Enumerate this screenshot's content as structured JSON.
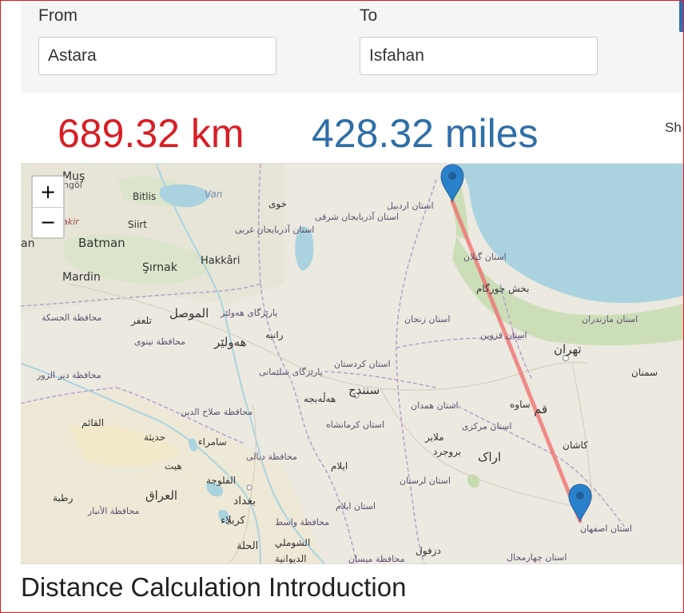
{
  "form": {
    "from_label": "From",
    "from_value": "Astara",
    "to_label": "To",
    "to_value": "Isfahan"
  },
  "result": {
    "km": "689.32 km",
    "miles": "428.32 miles",
    "share_stub": "Sh"
  },
  "colors": {
    "km": "#d71f26",
    "miles": "#2f6ea8",
    "route": "#ef6b6b",
    "marker": "#2a81cb",
    "water": "#aad3df",
    "land": "#ece9e1",
    "border": "#b39bc8"
  },
  "map": {
    "zoom_in": "+",
    "zoom_out": "−",
    "labels": {
      "mus": "Muş",
      "bingol": "ingöl",
      "bitlis": "Bitlis",
      "van": "Van",
      "siirt": "Siirt",
      "batman": "Batman",
      "hakkari": "Hakkâri",
      "sirnak": "Şırnak",
      "mardin": "Mardin",
      "akir": "akir",
      "an": "an",
      "ardabil_prov": "استان اردبیل",
      "khoy": "خوی",
      "w_azarbaijan": "استان آذربایجان غربی",
      "e_azarbaijan": "استان آذربایجان شرقی",
      "gilan": "استان گیلان",
      "bakhsh": "بخش چورگام",
      "zanjan": "استان زنجان",
      "mazandaran": "استان مازندران",
      "qazvin": "استان قزوین",
      "tehran": "تهران",
      "semnan": "سمنان",
      "mosul": "الموصل",
      "nineveh": "محافظة نينوى",
      "hasakah": "محافظة الحسكة",
      "erbil": "هەولێر",
      "erbil_gov": "پارێزگای هەولێر",
      "raniyeh": "رانیه",
      "talafar": "تلعفر",
      "deir": "محافظة دير الزور",
      "kurdistan": "استان کردستان",
      "sanandaj": "سنندج",
      "sulaymaniyah": "پارێزگای سلێمانی",
      "halabja": "هەڵەبجە",
      "hamadan": "استان همدان",
      "saveh": "ساوه",
      "qom": "قم",
      "kermanshah": "استان کرمانشاه",
      "markazi": "استان مرکزی",
      "kashan": "کاشان",
      "qaim": "القائم",
      "haditha": "حديثة",
      "salahaddin": "محافظة صلاح الدين",
      "samarra": "سامراء",
      "hit": "هيت",
      "diyala": "محافظة ديالى",
      "ilam_city": "ایلام",
      "malayer": "ملایر",
      "borujerd": "بروجرد",
      "arak": "اراک",
      "lorestan": "استان لرستان",
      "ilam": "استان ایلام",
      "isfahan_prov": "استان اصفهان",
      "rutba": "رطبة",
      "iraq": "العراق",
      "anbar": "محافظة الأنبار",
      "fallujah": "الفلوجة",
      "baghdad": "بغداد",
      "karbala": "كربلاء",
      "wasit": "محافظة واسط",
      "hillah": "الحلة",
      "shomali": "الشوملي",
      "diwaniyah": "الديوانية",
      "dezful": "دزفول",
      "chaharmahal": "استان چهارمحال",
      "maysan": "محافظة ميسان"
    }
  }
}
